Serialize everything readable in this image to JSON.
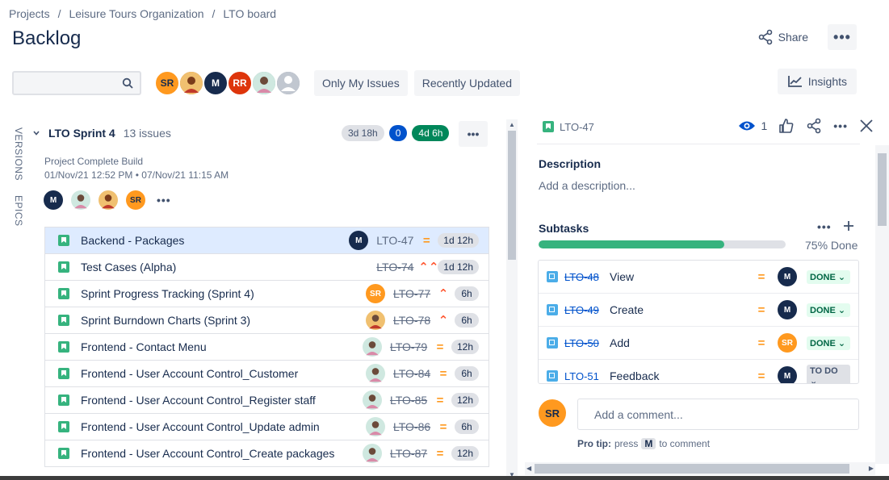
{
  "breadcrumb": [
    "Projects",
    "Leisure Tours Organization",
    "LTO board"
  ],
  "page_title": "Backlog",
  "header": {
    "share_label": "Share",
    "more_label": "•••"
  },
  "toolbar": {
    "search_placeholder": "",
    "avatars": [
      {
        "initials": "SR",
        "color": "#ff991f",
        "text_color": "#172b4d"
      },
      {
        "initials": "",
        "color": "#d9822b"
      },
      {
        "initials": "M",
        "color": "#172b4d"
      },
      {
        "initials": "RR",
        "color": "#de350b"
      },
      {
        "initials": "",
        "color": "#79b6a8"
      },
      {
        "initials": "",
        "color": "#97a0af"
      }
    ],
    "filters": [
      "Only My Issues",
      "Recently Updated"
    ],
    "insights_label": "Insights"
  },
  "side_tabs": [
    "VERSIONS",
    "EPICS"
  ],
  "sprint": {
    "name": "LTO Sprint 4",
    "issue_count": "13 issues",
    "badges": [
      "3d 18h",
      "0",
      "4d 6h"
    ],
    "goal": "Project Complete Build",
    "dates": "01/Nov/21 12:52 PM • 07/Nov/21 11:15 AM",
    "more_label": "•••"
  },
  "issues": [
    {
      "title": "Backend - Packages",
      "key": "LTO-47",
      "done": false,
      "priority": "medium",
      "estimate": "1d 12h",
      "avatar": "M",
      "avatar_color": "#172b4d",
      "selected": true
    },
    {
      "title": "Test Cases (Alpha)",
      "key": "LTO-74",
      "done": true,
      "priority": "highest",
      "estimate": "1d 12h",
      "avatar": "",
      "avatar_color": ""
    },
    {
      "title": "Sprint Progress Tracking (Sprint 4)",
      "key": "LTO-77",
      "done": true,
      "priority": "high",
      "estimate": "6h",
      "avatar": "SR",
      "avatar_color": "#ff991f"
    },
    {
      "title": "Sprint Burndown Charts (Sprint 3)",
      "key": "LTO-78",
      "done": true,
      "priority": "high",
      "estimate": "6h",
      "avatar": "",
      "avatar_color": "#d9822b"
    },
    {
      "title": "Frontend - Contact Menu",
      "key": "LTO-79",
      "done": true,
      "priority": "medium",
      "estimate": "12h",
      "avatar": "",
      "avatar_color": "#79b6a8"
    },
    {
      "title": "Frontend - User Account Control_Customer",
      "key": "LTO-84",
      "done": true,
      "priority": "medium",
      "estimate": "6h",
      "avatar": "",
      "avatar_color": "#79b6a8"
    },
    {
      "title": "Frontend - User Account Control_Register staff",
      "key": "LTO-85",
      "done": true,
      "priority": "medium",
      "estimate": "12h",
      "avatar": "",
      "avatar_color": "#79b6a8"
    },
    {
      "title": "Frontend - User Account Control_Update admin",
      "key": "LTO-86",
      "done": true,
      "priority": "medium",
      "estimate": "6h",
      "avatar": "",
      "avatar_color": "#79b6a8"
    },
    {
      "title": "Frontend - User Account Control_Create packages",
      "key": "LTO-87",
      "done": true,
      "priority": "medium",
      "estimate": "12h",
      "avatar": "",
      "avatar_color": "#79b6a8"
    }
  ],
  "detail": {
    "key": "LTO-47",
    "watch_count": "1",
    "description_label": "Description",
    "description_placeholder": "Add a description...",
    "subtasks_label": "Subtasks",
    "progress_fraction": 0.75,
    "progress_label": "75% Done",
    "subtasks": [
      {
        "key": "LTO-48",
        "title": "View",
        "done": true,
        "avatar": "M",
        "avatar_color": "#172b4d",
        "status": "DONE"
      },
      {
        "key": "LTO-49",
        "title": "Create",
        "done": true,
        "avatar": "M",
        "avatar_color": "#172b4d",
        "status": "DONE"
      },
      {
        "key": "LTO-50",
        "title": "Add",
        "done": true,
        "avatar": "SR",
        "avatar_color": "#ff991f",
        "status": "DONE"
      },
      {
        "key": "LTO-51",
        "title": "Feedback",
        "done": false,
        "avatar": "M",
        "avatar_color": "#172b4d",
        "status": "TO DO"
      }
    ],
    "comment_avatar": "SR",
    "comment_placeholder": "Add a comment...",
    "pro_tip_label": "Pro tip:",
    "pro_tip_press": "press",
    "pro_tip_key": "M",
    "pro_tip_suffix": "to comment"
  }
}
